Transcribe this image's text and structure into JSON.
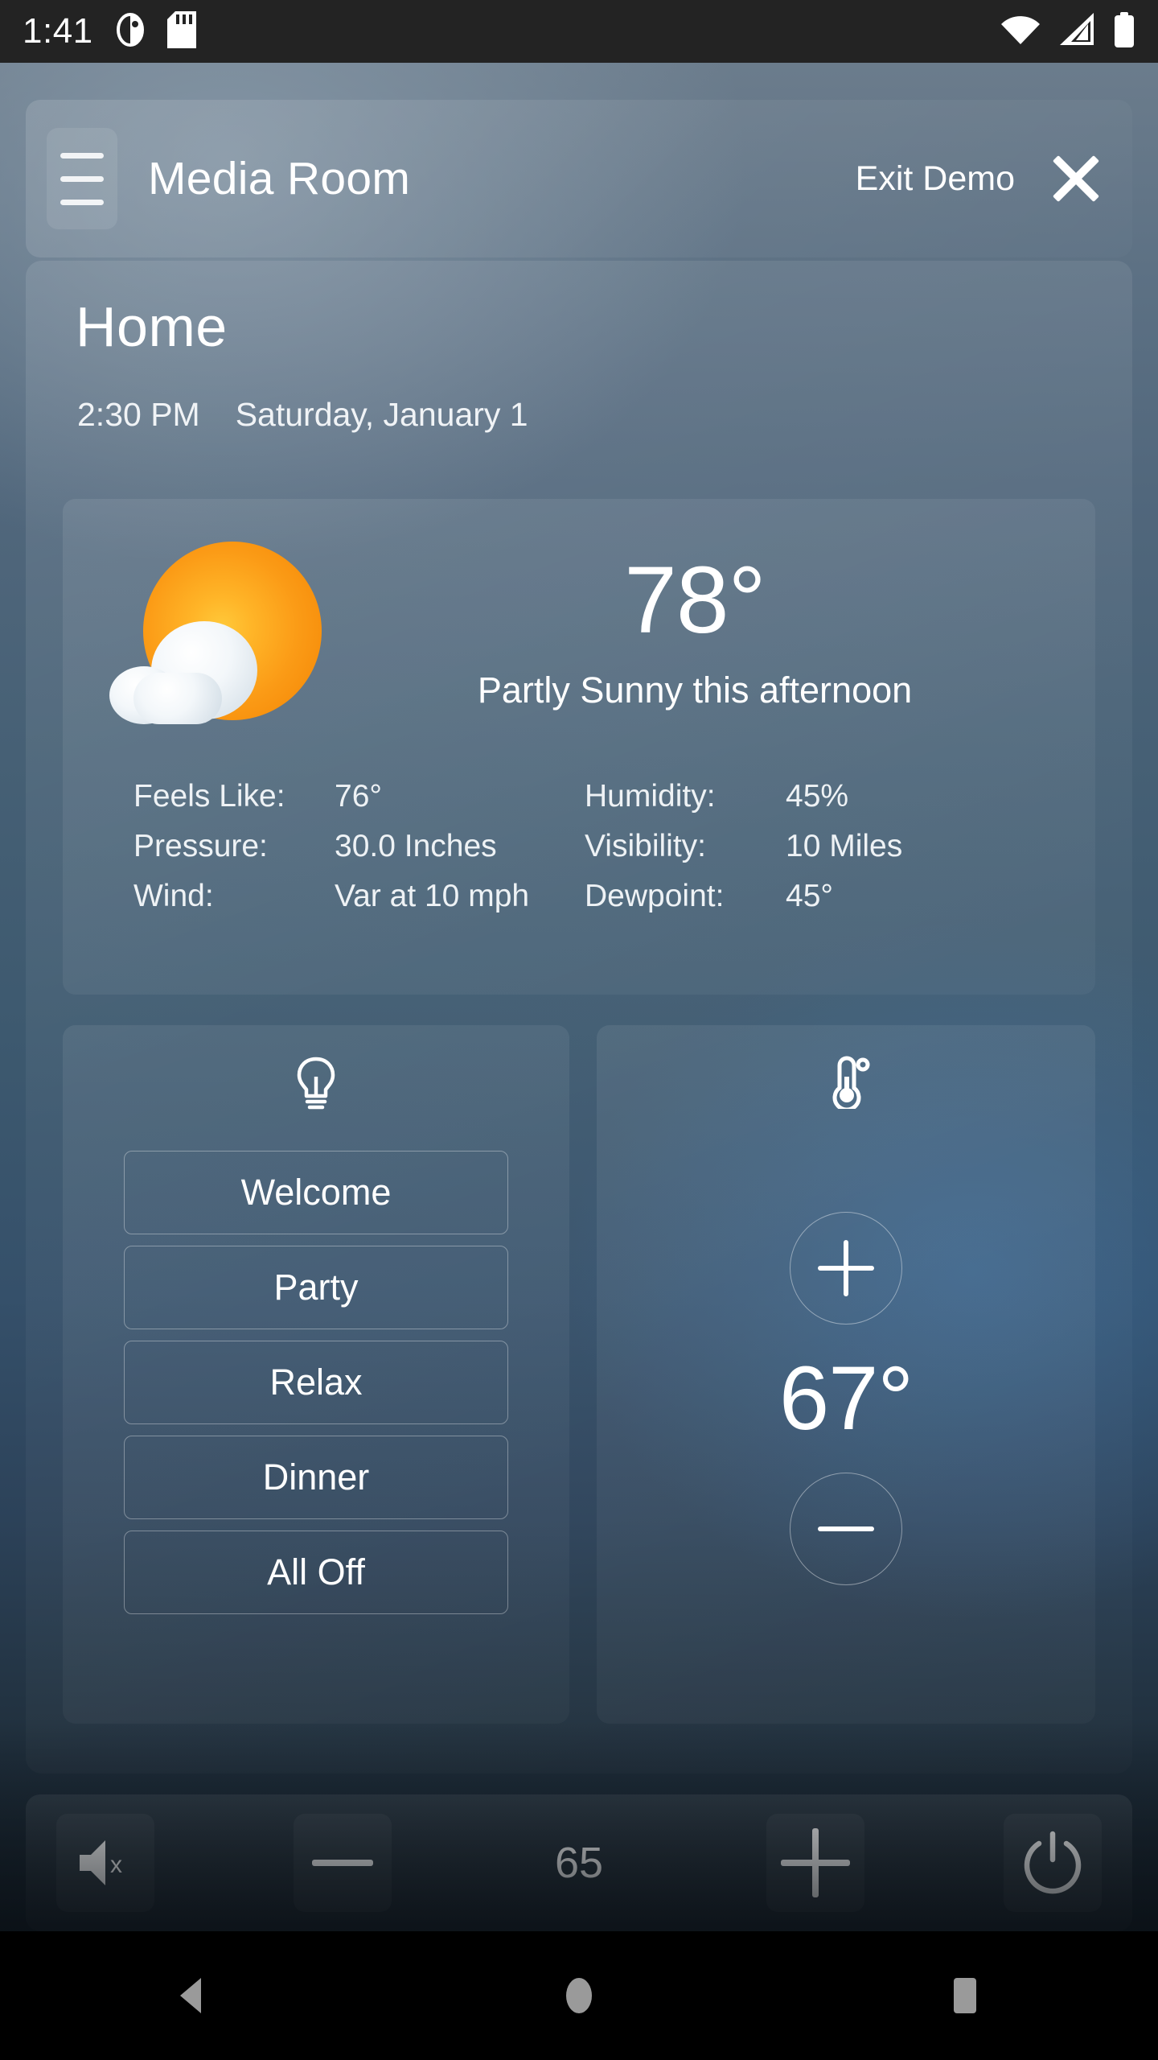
{
  "status_bar": {
    "time": "1:41",
    "left_icons": [
      "camera-blocked-icon",
      "sd-card-icon"
    ],
    "right_icons": [
      "wifi-icon",
      "cellular-signal-icon",
      "battery-icon"
    ]
  },
  "header": {
    "menu_icon": "hamburger-menu-icon",
    "room_title": "Media Room",
    "exit_label": "Exit Demo",
    "close_icon": "close-icon"
  },
  "main": {
    "page_title": "Home",
    "time": "2:30 PM",
    "date": "Saturday, January 1"
  },
  "weather": {
    "icon": "partly-sunny-icon",
    "temperature": "78°",
    "description": "Partly Sunny this afternoon",
    "details_left": [
      {
        "label": "Feels Like:",
        "value": "76°"
      },
      {
        "label": "Pressure:",
        "value": "30.0 Inches"
      },
      {
        "label": "Wind:",
        "value": "Var at 10 mph"
      }
    ],
    "details_right": [
      {
        "label": "Humidity:",
        "value": "45%"
      },
      {
        "label": "Visibility:",
        "value": "10 Miles"
      },
      {
        "label": "Dewpoint:",
        "value": "45°"
      }
    ]
  },
  "lighting": {
    "icon": "lightbulb-icon",
    "scenes": [
      "Welcome",
      "Party",
      "Relax",
      "Dinner",
      "All Off"
    ]
  },
  "thermostat": {
    "icon": "thermometer-icon",
    "increase_icon": "plus-icon",
    "decrease_icon": "minus-icon",
    "setpoint": "67°"
  },
  "toolbar": {
    "mute_icon": "volume-mute-icon",
    "volume_down_icon": "minus-icon",
    "volume_value": "65",
    "volume_up_icon": "plus-icon",
    "power_icon": "power-icon"
  },
  "nav_bar": {
    "back_icon": "back-triangle-icon",
    "home_icon": "home-circle-icon",
    "recents_icon": "recents-square-icon"
  },
  "colors": {
    "status_bar_bg": "#232323",
    "nav_bar_bg": "#000000",
    "bg_top": "#6b7c8c",
    "bg_bottom": "#151f28",
    "sun_orange": "#f78f0c",
    "sun_yellow": "#ffc93a",
    "text_primary": "#ffffff"
  }
}
